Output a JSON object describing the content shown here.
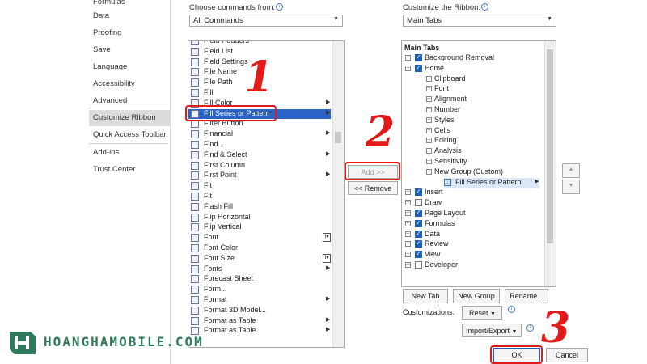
{
  "nav": {
    "items": [
      {
        "label": "Formulas"
      },
      {
        "label": "Data"
      },
      {
        "label": "Proofing"
      },
      {
        "label": "Save"
      },
      {
        "label": "Language"
      },
      {
        "label": "Accessibility"
      },
      {
        "label": "Advanced"
      },
      {
        "label": "Customize Ribbon"
      },
      {
        "label": "Quick Access Toolbar"
      },
      {
        "label": "Add-ins"
      },
      {
        "label": "Trust Center"
      }
    ],
    "selected": "Customize Ribbon"
  },
  "choose_commands": {
    "label": "Choose commands from:",
    "value": "All Commands"
  },
  "customize_ribbon": {
    "label": "Customize the Ribbon:",
    "value": "Main Tabs"
  },
  "commands": [
    {
      "label": "Field Headers"
    },
    {
      "label": "Field List"
    },
    {
      "label": "Field Settings"
    },
    {
      "label": "File Name"
    },
    {
      "label": "File Path"
    },
    {
      "label": "Fill"
    },
    {
      "label": "Fill Color"
    },
    {
      "label": "Fill Series or Pattern",
      "selected": true
    },
    {
      "label": "Filter Button"
    },
    {
      "label": "Financial"
    },
    {
      "label": "Find..."
    },
    {
      "label": "Find & Select"
    },
    {
      "label": "First Column"
    },
    {
      "label": "First Point"
    },
    {
      "label": "Fit"
    },
    {
      "label": "Fit"
    },
    {
      "label": "Flash Fill"
    },
    {
      "label": "Flip Horizontal"
    },
    {
      "label": "Flip Vertical"
    },
    {
      "label": "Font"
    },
    {
      "label": "Font Color"
    },
    {
      "label": "Font Size"
    },
    {
      "label": "Fonts"
    },
    {
      "label": "Forecast Sheet"
    },
    {
      "label": "Form..."
    },
    {
      "label": "Format"
    },
    {
      "label": "Format 3D Model..."
    },
    {
      "label": "Format as Table"
    },
    {
      "label": "Format as Table"
    }
  ],
  "buttons": {
    "add": "Add >>",
    "remove": "<< Remove",
    "new_tab": "New Tab",
    "new_group": "New Group",
    "rename": "Rename...",
    "customizations": "Customizations:",
    "reset": "Reset",
    "import_export": "Import/Export",
    "ok": "OK",
    "cancel": "Cancel"
  },
  "tree": {
    "header": "Main Tabs",
    "items": [
      {
        "label": "Background Removal",
        "level": 0,
        "checked": true,
        "expander": "+"
      },
      {
        "label": "Home",
        "level": 0,
        "checked": true,
        "expander": "-"
      },
      {
        "label": "Clipboard",
        "level": 1,
        "expander": "+"
      },
      {
        "label": "Font",
        "level": 1,
        "expander": "+"
      },
      {
        "label": "Alignment",
        "level": 1,
        "expander": "+"
      },
      {
        "label": "Number",
        "level": 1,
        "expander": "+"
      },
      {
        "label": "Styles",
        "level": 1,
        "expander": "+"
      },
      {
        "label": "Cells",
        "level": 1,
        "expander": "+"
      },
      {
        "label": "Editing",
        "level": 1,
        "expander": "+"
      },
      {
        "label": "Analysis",
        "level": 1,
        "expander": "+"
      },
      {
        "label": "Sensitivity",
        "level": 1,
        "expander": "+"
      },
      {
        "label": "New Group (Custom)",
        "level": 1,
        "expander": "-"
      },
      {
        "label": "Fill Series or Pattern",
        "level": 2,
        "selected": true
      },
      {
        "label": "Insert",
        "level": 0,
        "checked": true,
        "expander": "+"
      },
      {
        "label": "Draw",
        "level": 0,
        "checked": false,
        "expander": "+"
      },
      {
        "label": "Page Layout",
        "level": 0,
        "checked": true,
        "expander": "+"
      },
      {
        "label": "Formulas",
        "level": 0,
        "checked": true,
        "expander": "+"
      },
      {
        "label": "Data",
        "level": 0,
        "checked": true,
        "expander": "+"
      },
      {
        "label": "Review",
        "level": 0,
        "checked": true,
        "expander": "+"
      },
      {
        "label": "View",
        "level": 0,
        "checked": true,
        "expander": "+"
      },
      {
        "label": "Developer",
        "level": 0,
        "checked": false,
        "expander": "+"
      }
    ]
  },
  "annotations": {
    "step1": "1",
    "step2": "2",
    "step3": "3"
  },
  "watermark": {
    "text": "HOANGHAMOBILE.COM"
  },
  "colors": {
    "accent": "#2a63c5",
    "annotation": "#e21a1a",
    "watermark": "#2f7a5a"
  }
}
